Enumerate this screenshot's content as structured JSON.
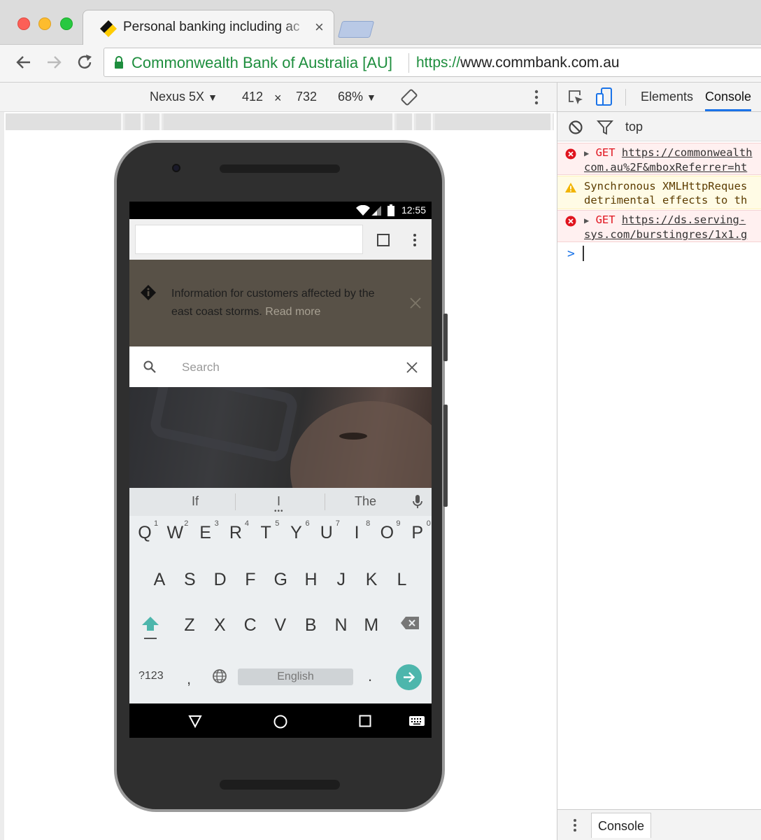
{
  "window": {
    "tab_title": "Personal banking including ac",
    "tab_close": "×"
  },
  "address_bar": {
    "site_identity": "Commonwealth Bank of Australia [AU]",
    "url_scheme": "https://",
    "url_host": "www.commbank.com.au"
  },
  "device_toolbar": {
    "device": "Nexus 5X",
    "width": "412",
    "times": "×",
    "height": "732",
    "zoom": "68%"
  },
  "phone": {
    "status_time": "12:55",
    "banner": {
      "text": "Information for customers affected by the east coast storms.",
      "link": "Read more"
    },
    "search": {
      "placeholder": "Search"
    },
    "keyboard": {
      "suggestions": [
        "If",
        "I",
        "The"
      ],
      "row1": [
        "Q",
        "W",
        "E",
        "R",
        "T",
        "Y",
        "U",
        "I",
        "O",
        "P"
      ],
      "row1_hints": [
        "1",
        "2",
        "3",
        "4",
        "5",
        "6",
        "7",
        "8",
        "9",
        "0"
      ],
      "row2": [
        "A",
        "S",
        "D",
        "F",
        "G",
        "H",
        "J",
        "K",
        "L"
      ],
      "row3": [
        "Z",
        "X",
        "C",
        "V",
        "B",
        "N",
        "M"
      ],
      "symbols_key": "?123",
      "comma_key": ",",
      "space_label": "English",
      "period_key": "."
    }
  },
  "devtools": {
    "tabs": [
      "Elements",
      "Console"
    ],
    "active_tab": "Console",
    "context": "top",
    "messages": [
      {
        "level": "error",
        "method": "GET",
        "line1": "https://commonwealth",
        "line2": "com.au%2F&mboxReferrer=ht"
      },
      {
        "level": "warning",
        "line1": "Synchronous XMLHttpReques",
        "line2": "detrimental effects to th"
      },
      {
        "level": "error",
        "method": "GET",
        "line1": "https://ds.serving-",
        "line2": "sys.com/burstingres/1x1.g"
      }
    ],
    "prompt": ">",
    "drawer_tab": "Console"
  },
  "colors": {
    "secure_green": "#1e8e3e",
    "banner_bg": "#585147",
    "accent_teal": "#4db6ac",
    "error_red": "#e0141e"
  }
}
